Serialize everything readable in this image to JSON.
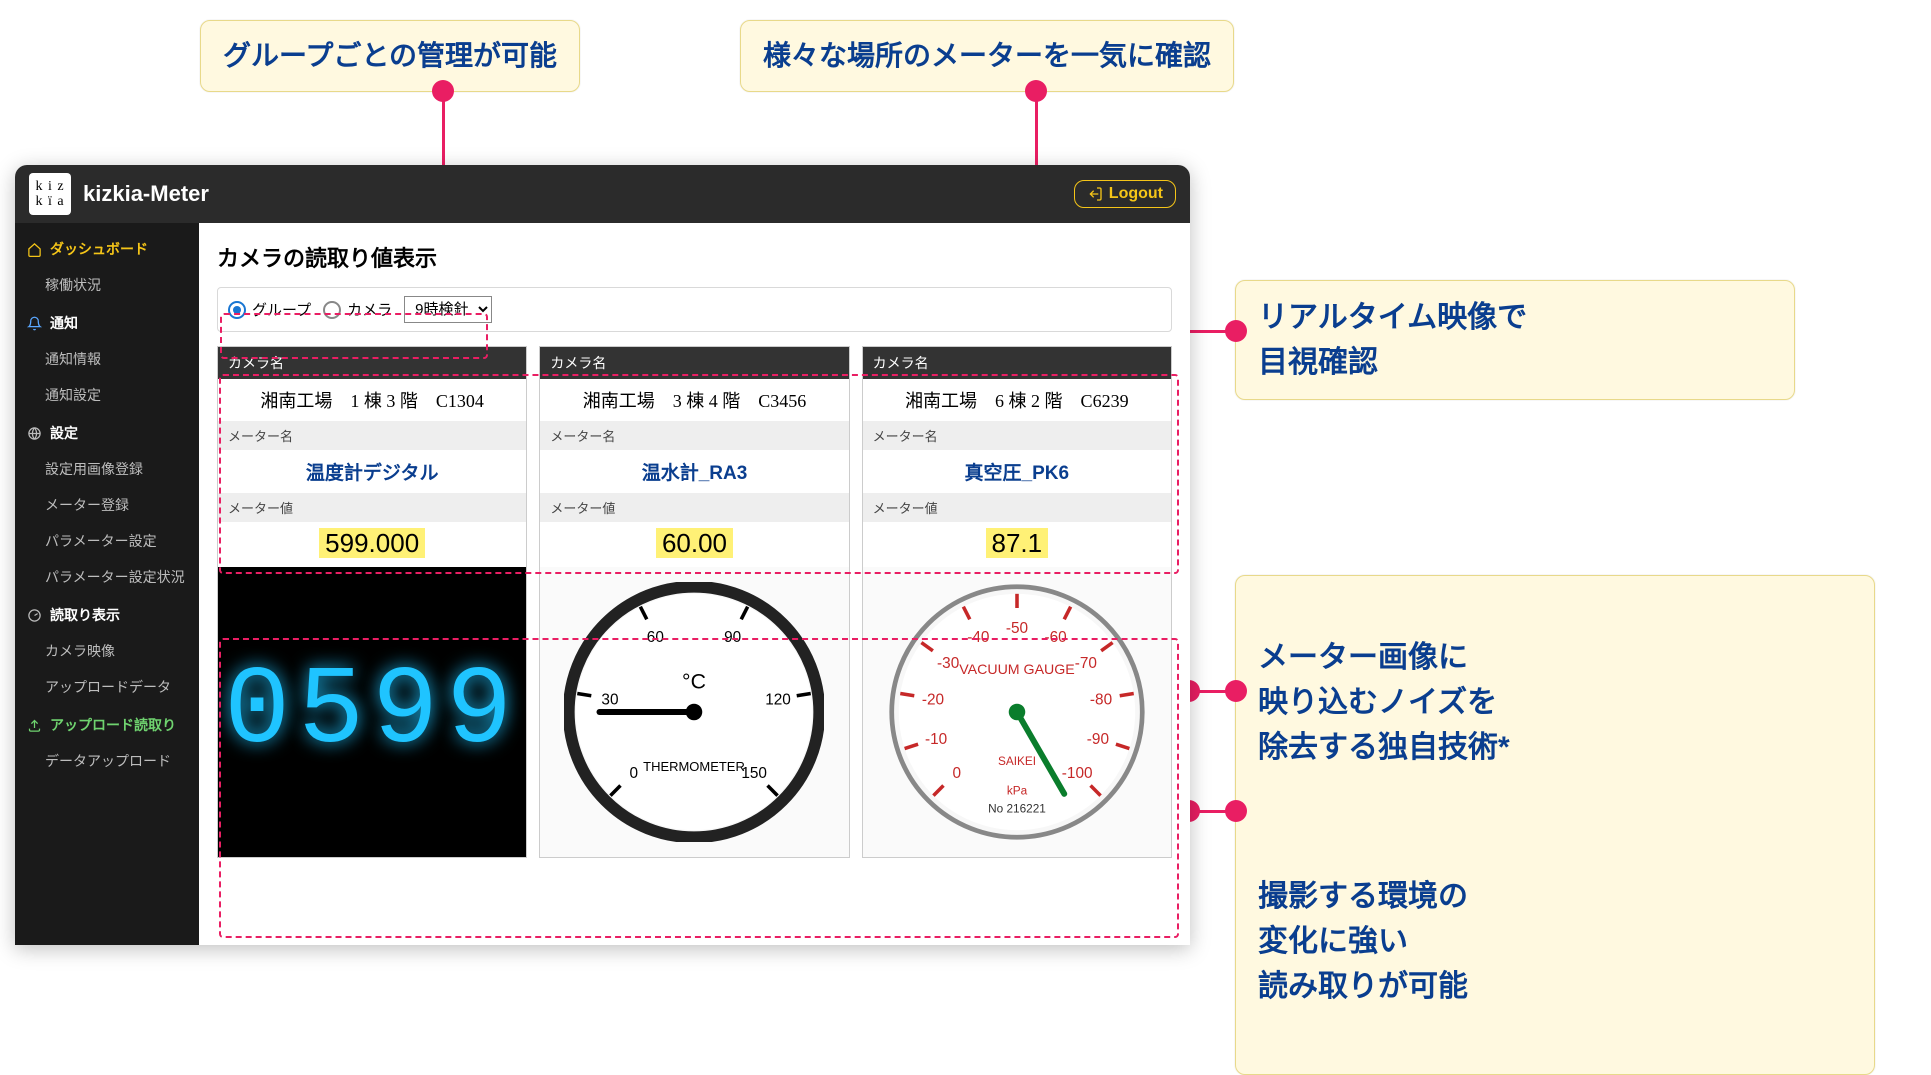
{
  "annotations": {
    "top_left": "グループごとの管理が可能",
    "top_right": "様々な場所のメーターを一気に確認",
    "right_1": "リアルタイム映像で\n目視確認",
    "right_2": "メーター画像に\n映り込むノイズを\n除去する独自技術*",
    "right_3": "撮影する環境の\n変化に強い\n読み取りが可能"
  },
  "header": {
    "app_title": "kizkia-Meter",
    "logo_lines": [
      "k i z",
      "k ï a"
    ],
    "logout": "Logout"
  },
  "sidebar": {
    "dashboard": {
      "title": "ダッシュボード",
      "items": [
        "稼働状況"
      ]
    },
    "notify": {
      "title": "通知",
      "items": [
        "通知情報",
        "通知設定"
      ]
    },
    "settings": {
      "title": "設定",
      "items": [
        "設定用画像登録",
        "メーター登録",
        "パラメーター設定",
        "パラメーター設定状況"
      ]
    },
    "reading": {
      "title": "読取り表示",
      "items": [
        "カメラ映像",
        "アップロードデータ"
      ]
    },
    "upload": {
      "title": "アップロード読取り",
      "items": [
        "データアップロード"
      ]
    }
  },
  "main": {
    "page_title": "カメラの読取り値表示",
    "filter": {
      "group_label": "グループ",
      "camera_label": "カメラ",
      "selected_option": "9時検針"
    },
    "col_labels": {
      "camera": "カメラ名",
      "meter_name": "メーター名",
      "meter_value": "メーター値"
    },
    "cards": [
      {
        "location": "湘南工場　1 棟 3 階　C1304",
        "meter_name": "温度計デジタル",
        "meter_value": "599.000",
        "image_kind": "lcd",
        "lcd_text": "0599"
      },
      {
        "location": "湘南工場　3 棟 4 階　C3456",
        "meter_name": "温水計_RA3",
        "meter_value": "60.00",
        "image_kind": "thermo",
        "gauge": {
          "center_label": "°C",
          "sub": "THERMOMETER",
          "ticks": [
            "0",
            "30",
            "60",
            "90",
            "120",
            "150"
          ],
          "needle_deg": 180
        }
      },
      {
        "location": "湘南工場　6 棟 2 階　C6239",
        "meter_name": "真空圧_PK6",
        "meter_value": "87.1",
        "image_kind": "vacuum",
        "gauge": {
          "center_label": "VACUUM GAUGE",
          "brand": "SAIKEI",
          "serial": "No 216221",
          "unit": "kPa",
          "ticks": [
            "0",
            "-10",
            "-20",
            "-30",
            "-40",
            "-50",
            "-60",
            "-70",
            "-80",
            "-90",
            "-100"
          ],
          "needle_deg": 60
        }
      }
    ]
  }
}
